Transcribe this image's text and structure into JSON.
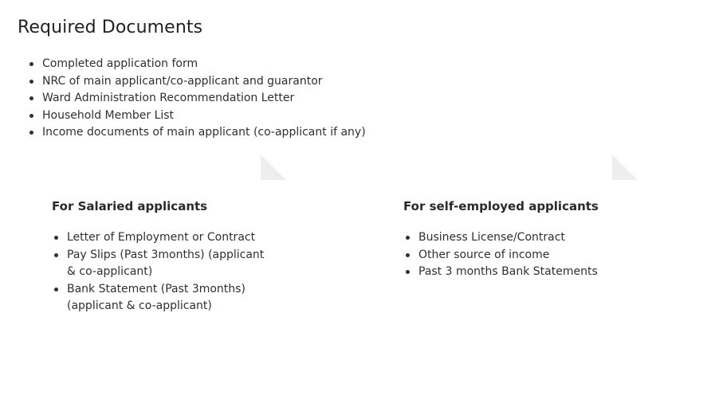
{
  "page": {
    "title": "Required Documents"
  },
  "required_documents": [
    "Completed application form",
    "NRC of main applicant/co-applicant and guarantor",
    "Ward Administration Recommendation Letter",
    "Household Member List",
    "Income documents of main applicant (co-applicant if any)"
  ],
  "cards": {
    "salaried": {
      "title": "For Salaried applicants",
      "items": [
        "Letter of Employment or Contract",
        "Pay Slips (Past 3months) (applicant & co-applicant)",
        "Bank Statement (Past 3months) (applicant & co-applicant)"
      ]
    },
    "self_employed": {
      "title": "For self-employed applicants",
      "items": [
        "Business License/Contract",
        "Other source of income",
        "Past 3 months Bank Statements"
      ]
    }
  }
}
